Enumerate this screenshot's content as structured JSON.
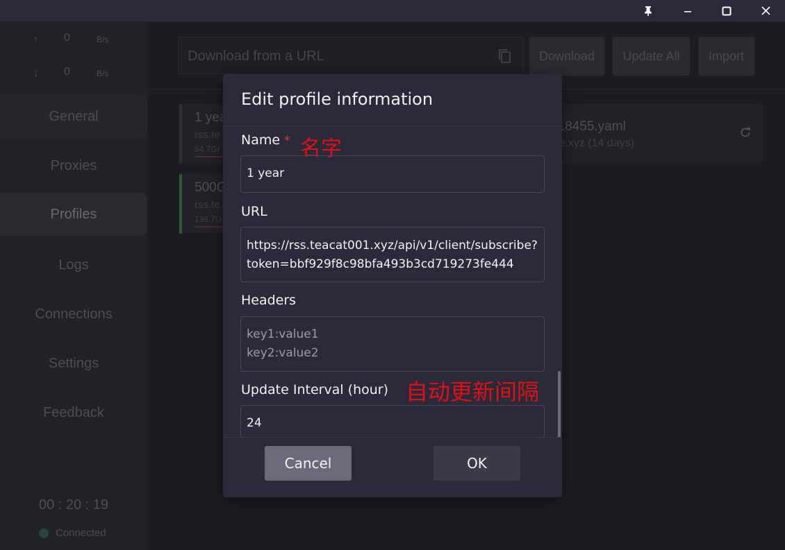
{
  "window": {
    "buttons": [
      "pin",
      "minimize",
      "maximize",
      "close"
    ]
  },
  "sidebar": {
    "upload": {
      "arrow": "↑",
      "value": "0",
      "unit": "B/s"
    },
    "download": {
      "arrow": "↓",
      "value": "0",
      "unit": "B/s"
    },
    "nav": [
      "General",
      "Proxies",
      "Profiles",
      "Logs",
      "Connections",
      "Settings",
      "Feedback"
    ],
    "active": "Profiles",
    "timer": "00 : 20 : 19",
    "status": "Connected"
  },
  "toolbar": {
    "url_placeholder": "Download from a URL",
    "download_label": "Download",
    "update_all_label": "Update All",
    "import_label": "Import"
  },
  "profiles": [
    {
      "title": "1 yea",
      "host": "rss.te",
      "usage": "54.7GI"
    },
    {
      "title": "500G",
      "host": "rss.te",
      "usage": "136.7G"
    },
    {
      "title": "818455.yaml",
      "host": "ibe.xyz (14 days)"
    }
  ],
  "dialog": {
    "title": "Edit profile information",
    "name_label": "Name",
    "required_mark": "*",
    "name_value": "1 year",
    "url_label": "URL",
    "url_value": "https://rss.teacat001.xyz/api/v1/client/subscribe?\ntoken=bbf929f8c98bfa493b3cd719273fe444",
    "headers_label": "Headers",
    "headers_placeholder": "key1:value1\nkey2:value2",
    "interval_label": "Update Interval (hour)",
    "interval_value": "24",
    "cancel_label": "Cancel",
    "ok_label": "OK"
  },
  "annotations": {
    "name_note": "名字",
    "interval_note": "自动更新间隔",
    "color": "#e0111b"
  }
}
